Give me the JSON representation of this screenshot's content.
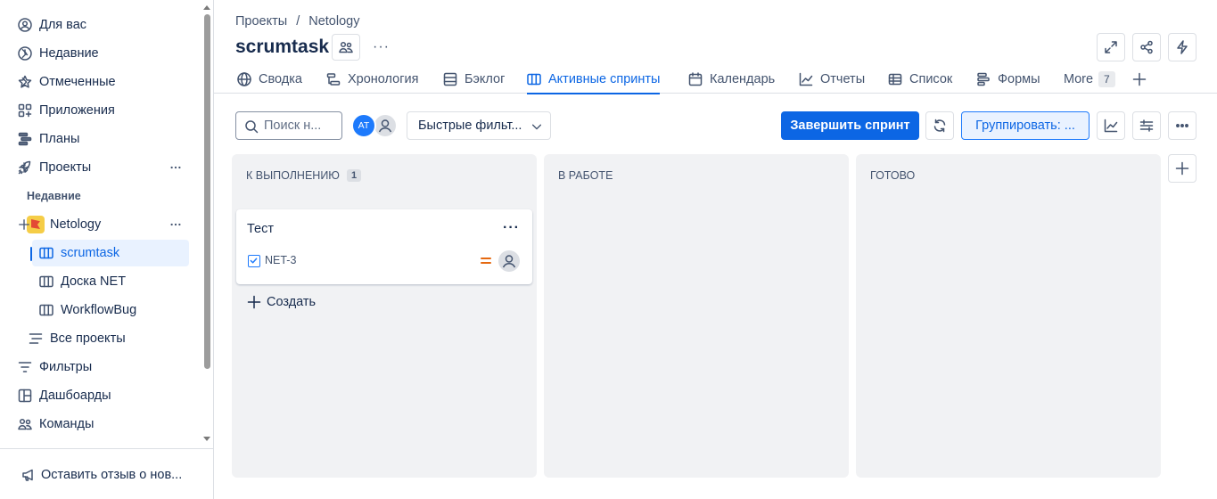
{
  "sidebar": {
    "items": [
      {
        "label": "Для вас"
      },
      {
        "label": "Недавние"
      },
      {
        "label": "Отмеченные"
      },
      {
        "label": "Приложения"
      },
      {
        "label": "Планы"
      },
      {
        "label": "Проекты"
      }
    ],
    "recent_heading": "Недавние",
    "project": {
      "label": "Netology"
    },
    "boards": [
      {
        "label": "scrumtask"
      },
      {
        "label": "Доска NET"
      },
      {
        "label": "WorkflowBug"
      }
    ],
    "all_projects": "Все проекты",
    "bottom_items": [
      {
        "label": "Фильтры"
      },
      {
        "label": "Дашбоарды"
      },
      {
        "label": "Команды"
      }
    ],
    "feedback": "Оставить отзыв о нов..."
  },
  "header": {
    "breadcrumb": [
      "Проекты",
      "/",
      "Netology"
    ],
    "title": "scrumtask",
    "more": "···"
  },
  "tabs": [
    {
      "label": "Сводка",
      "icon": "globe-icon"
    },
    {
      "label": "Хронология",
      "icon": "timeline-icon"
    },
    {
      "label": "Бэклог",
      "icon": "backlog-icon"
    },
    {
      "label": "Активные спринты",
      "icon": "board-icon",
      "active": true
    },
    {
      "label": "Календарь",
      "icon": "calendar-icon"
    },
    {
      "label": "Отчеты",
      "icon": "reports-icon"
    },
    {
      "label": "Список",
      "icon": "list-icon"
    },
    {
      "label": "Формы",
      "icon": "forms-icon"
    },
    {
      "label": "More",
      "count": "7"
    }
  ],
  "toolbar": {
    "search_placeholder": "Поиск н...",
    "avatar_initials": "AT",
    "quick_filters": "Быстрые фильт...",
    "complete_sprint": "Завершить спринт",
    "group_by": "Группировать: ..."
  },
  "board": {
    "columns": [
      {
        "title": "К ВЫПОЛНЕНИЮ",
        "count": "1"
      },
      {
        "title": "В РАБОТЕ"
      },
      {
        "title": "ГОТОВО"
      }
    ],
    "card": {
      "title": "Тест",
      "key": "NET-3",
      "priority": "medium"
    },
    "create_label": "Создать"
  },
  "colors": {
    "accent": "#0c66e4",
    "priority_medium": "#e56910"
  }
}
